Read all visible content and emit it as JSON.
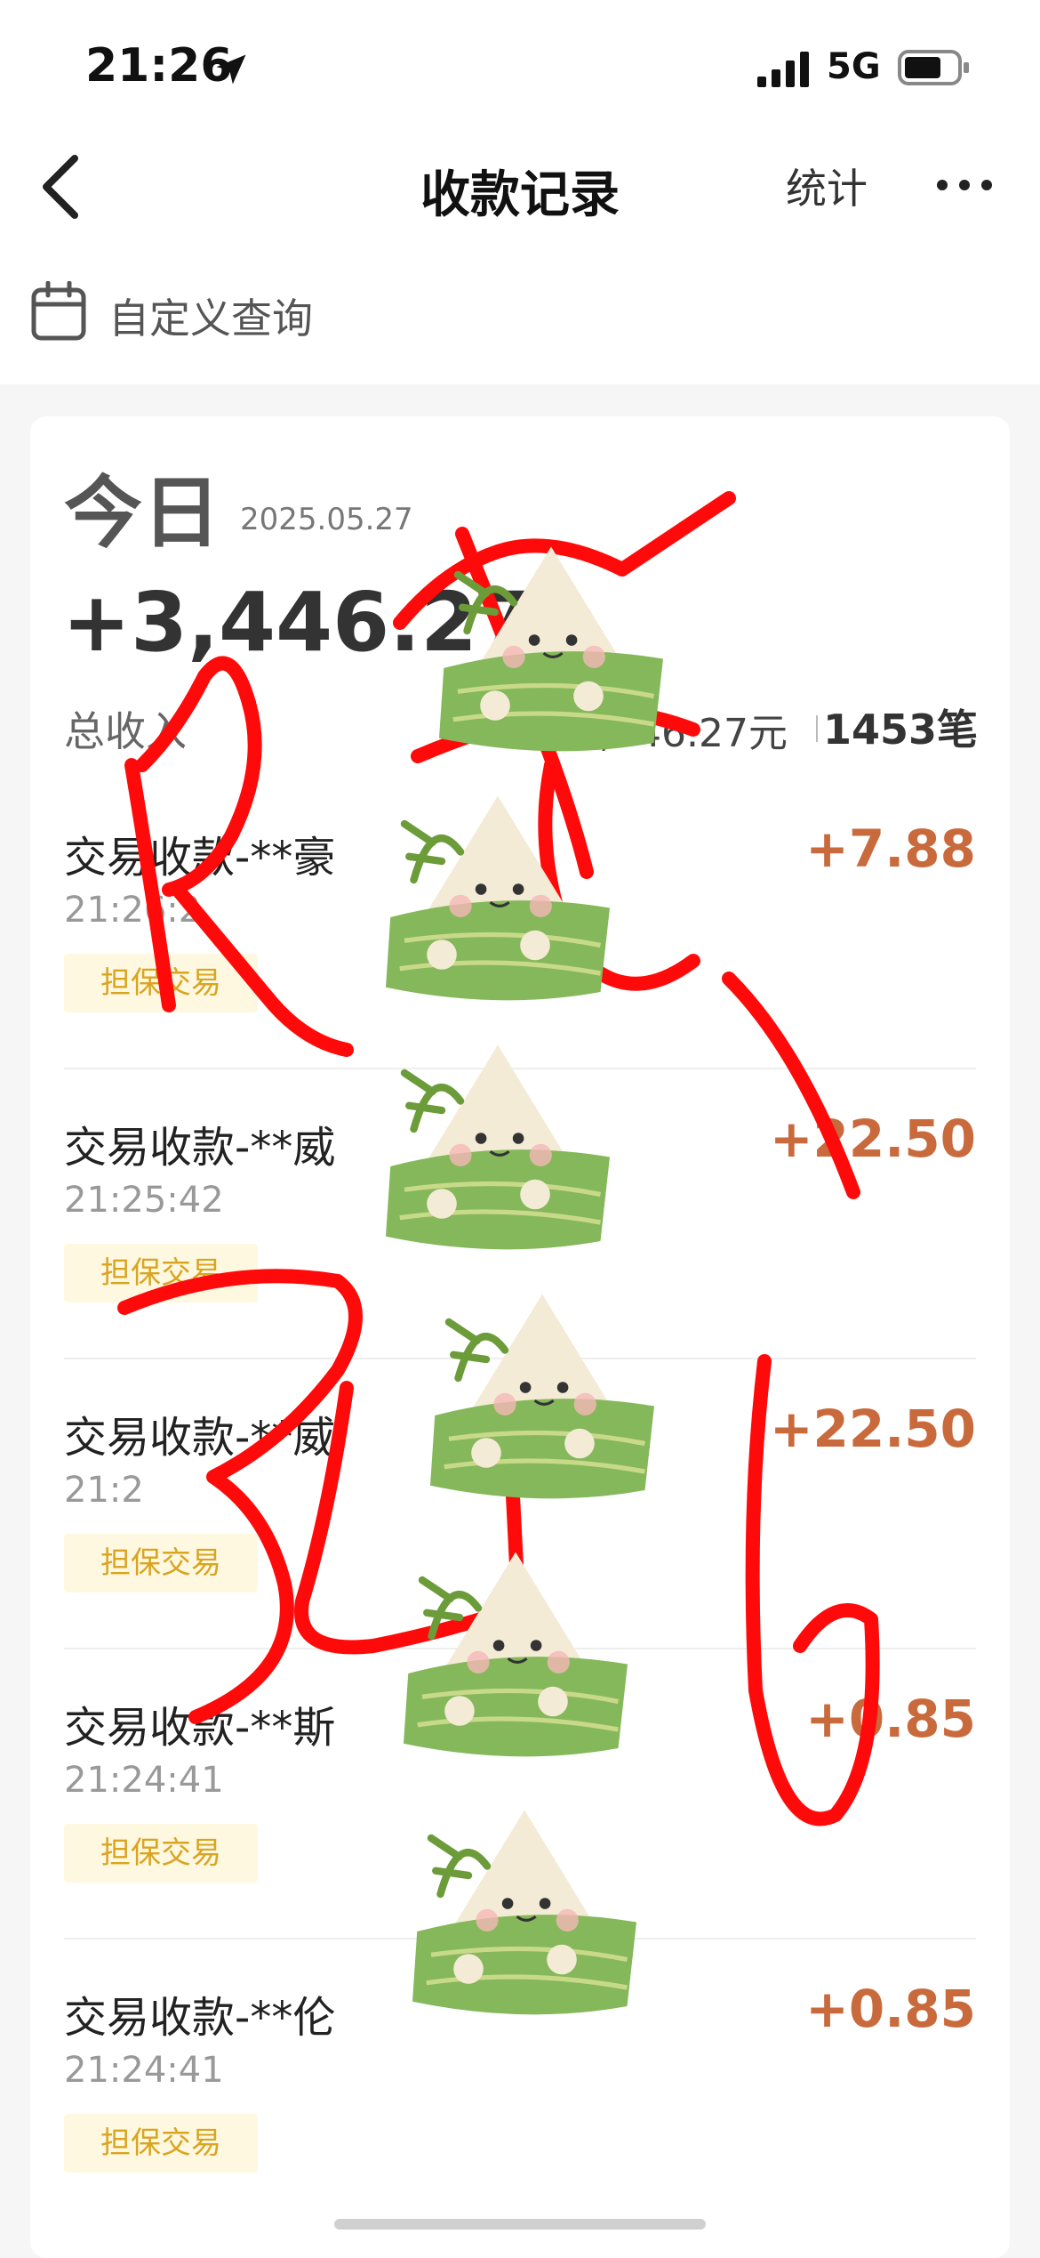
{
  "status": {
    "time": "21:26",
    "network": "5G",
    "icons": [
      "location-arrow-icon",
      "signal-icon",
      "battery-icon"
    ]
  },
  "nav": {
    "title": "收款记录",
    "stats_label": "统计",
    "back_icon": "chevron-left-icon",
    "more_icon": "more-icon"
  },
  "filter": {
    "label": "自定义查询",
    "icon": "calendar-icon"
  },
  "summary": {
    "day_label": "今日",
    "date": "2025.05.27",
    "amount": "+3,446.27",
    "total_label": "总收入",
    "total_amount": "3,446.27元",
    "count": "1453笔"
  },
  "transactions": [
    {
      "title": "交易收款-**豪",
      "time": "21:26:2",
      "amount": "+7.88",
      "badge": "担保交易"
    },
    {
      "title": "交易收款-**威",
      "time": "21:25:42",
      "amount": "+22.50",
      "badge": "担保交易"
    },
    {
      "title": "交易收款-**威",
      "time": "21:2",
      "amount": "+22.50",
      "badge": "担保交易"
    },
    {
      "title": "交易收款-**斯",
      "time": "21:24:41",
      "amount": "+0.85",
      "badge": "担保交易"
    },
    {
      "title": "交易收款-**伦",
      "time": "21:24:41",
      "amount": "+0.85",
      "badge": "担保交易"
    }
  ],
  "colors": {
    "amount": "#c96a3d",
    "badge_bg": "#fff8e1",
    "badge_text": "#d9a520",
    "scribble": "#ff0a0a",
    "zongzi_green": "#7ab24e"
  }
}
